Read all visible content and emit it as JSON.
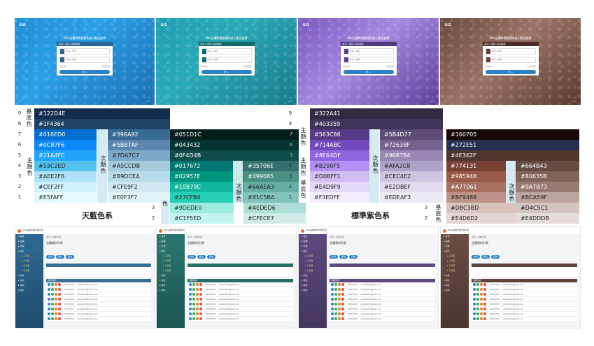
{
  "login_previews": [
    {
      "bg": "linear-gradient(135deg,#1f8fd8 0%,#2b9fe6 40%,#1b6fb3 100%)",
      "header": "#2c6496",
      "button": "#2c82c9",
      "icon": "#2c6496",
      "title": "FDA品種特價管理系統 | 歡迎使用",
      "box_header": "歡迎！請登入您的帳號",
      "field_user": "請輸入帳號",
      "field_pass": "請輸入密碼",
      "remember": "記住我",
      "forgot": "忘記密碼",
      "button_label": "登 入"
    },
    {
      "bg": "linear-gradient(135deg,#1f9fb2 0%,#2aa9b8 40%,#1a7b8c 100%)",
      "header": "#136a6a",
      "button": "#2c82c9",
      "icon": "#136a6a",
      "title": "FDA品種特價管理系統 | 歡迎使用",
      "box_header": "歡迎！請登入您的帳號",
      "field_user": "請輸入帳號",
      "field_pass": "請輸入密碼",
      "remember": "記住我",
      "forgot": "忘記密碼",
      "button_label": "登 入"
    },
    {
      "bg": "linear-gradient(135deg,#7b58c2 0%,#a58ae0 45%,#5c3f9a 100%)",
      "header": "#4f3a7d",
      "button": "#2c82c9",
      "icon": "#5b3e97",
      "title": "FDA品種特價管理系統 | 歡迎使用",
      "box_header": "歡迎！請登入您的帳號",
      "field_user": "請輸入帳號",
      "field_pass": "請輸入密碼",
      "remember": "記住我",
      "forgot": "忘記密碼",
      "button_label": "登 入"
    },
    {
      "bg": "linear-gradient(135deg,#6a4a3c 0%,#9b7466 45%,#5a3a2e 100%)",
      "header": "#4b2f26",
      "button": "#2c82c9",
      "icon": "#6a3e30",
      "title": "FDA品種特價管理系統 | 歡迎使用",
      "box_header": "歡迎！請登入您的帳號",
      "field_user": "請輸入帳號",
      "field_pass": "請輸入密碼",
      "remember": "記住我",
      "forgot": "忘記密碼",
      "button_label": "登 入"
    }
  ],
  "labels": {
    "base": "基底色",
    "primary": "主顏色",
    "secondary": "次顏色",
    "sky_title": "天藍色系",
    "purple_title": "標準紫色系"
  },
  "sky": {
    "base": [
      {
        "n": "9",
        "hex": "#122D4E"
      },
      {
        "n": "8",
        "hex": "#1F4364"
      }
    ],
    "primary": [
      {
        "n": "7",
        "hex": "#016ED0"
      },
      {
        "n": "6",
        "hex": "#0C87F6"
      },
      {
        "n": "5",
        "hex": "#21A4FC"
      },
      {
        "n": "4",
        "hex": "#53C2ED"
      },
      {
        "n": "3",
        "hex": "#AEE2F6"
      },
      {
        "n": "2",
        "hex": "#CEF2FF"
      },
      {
        "n": "1",
        "hex": "#E5FAFF"
      }
    ],
    "secondary": [
      "#396A92",
      "#5B87AF",
      "#7DA7C7",
      "#A5CCDB",
      "#B9DCEA",
      "#CFE9F2",
      "#E0F3F7"
    ]
  },
  "teal": {
    "primary": [
      {
        "n": "7",
        "hex": "#051D1C"
      },
      {
        "n": "6",
        "hex": "#043432"
      },
      {
        "n": "5",
        "hex": "#0F4D4B"
      },
      {
        "n": "4",
        "hex": "#017672"
      },
      {
        "n": "3",
        "hex": "#02957E"
      },
      {
        "n": "2",
        "hex": "#10B79C"
      },
      {
        "n": "1",
        "hex": "#27CFB4"
      }
    ],
    "secondary": [
      "#35706E",
      "#499085",
      "#66AEA3",
      "#81C5BA"
    ],
    "base": [
      {
        "n": "3",
        "hex": "#9DEDE0",
        "sec": "#AEDED6"
      },
      {
        "n": "2",
        "hex": "#C1F5ED",
        "sec": "#CFECE7"
      }
    ],
    "base_mark": "色"
  },
  "purple": {
    "base": [
      {
        "n": "9",
        "hex": "#322A41"
      },
      {
        "n": "8",
        "hex": "#403359"
      }
    ],
    "primary": [
      {
        "n": "7",
        "hex": "#563C86"
      },
      {
        "n": "6",
        "hex": "#714ABC"
      },
      {
        "n": "5",
        "hex": "#8E64DF"
      },
      {
        "n": "4",
        "hex": "#B290F5"
      },
      {
        "n": "3",
        "hex": "#D0BFF1"
      },
      {
        "n": "2",
        "hex": "#E4D9F9"
      },
      {
        "n": "1",
        "hex": "#F3EDFF"
      }
    ],
    "secondary": [
      "#5B4D77",
      "#72638F",
      "#9687B4",
      "#AFA2C8",
      "#CEC4E2",
      "#E2DBEF",
      "#EDEAF3"
    ]
  },
  "brown": {
    "primary": [
      "#160705",
      "#272E51",
      "#4E362F",
      "#774131",
      "#985948",
      "#A77061",
      "#BF9488"
    ],
    "secondary": [
      "#664B43",
      "#80635B",
      "#9A7B73",
      "#BCA59F"
    ],
    "base": [
      {
        "n": "3",
        "hex": "#D8C3BD",
        "sec": "#D4C5C1"
      },
      {
        "n": "2",
        "hex": "#E4D6D2",
        "sec": "#E4DDDB"
      }
    ]
  },
  "dash_previews": [
    {
      "side": "#2e6a93",
      "side2": "#1f4a6c",
      "accent": "#2c82c9",
      "bar": "#3a6f96"
    },
    {
      "side": "#2a7770",
      "side2": "#1b5450",
      "accent": "#2c82c9",
      "bar": "#2b6e68"
    },
    {
      "side": "#5b4a7f",
      "side2": "#43365f",
      "accent": "#2c82c9",
      "bar": "#5c4b80"
    },
    {
      "side": "#6a4e45",
      "side2": "#4a3530",
      "accent": "#2c82c9",
      "bar": "#5e443c"
    }
  ],
  "dash_text": {
    "title": "FDA品種特價管理系統",
    "crumb": "首頁 / 品種管理",
    "heading": "品種資料列表",
    "pill1": "新增",
    "pill2": "匯出",
    "pill3": "查詢",
    "table_title": "資料列表",
    "row_email": "sample123@gmail.com",
    "row_date": "2023/03/01",
    "side_items": [
      "首頁",
      "品種",
      "管理",
      "設定",
      "子項目",
      "子項目",
      "子項目",
      "子項目",
      "系統",
      "報表",
      "帳號",
      "其他"
    ]
  },
  "check_colors": [
    "#2c82c9",
    "#27ae60",
    "#e67e22",
    "#e74c3c"
  ]
}
